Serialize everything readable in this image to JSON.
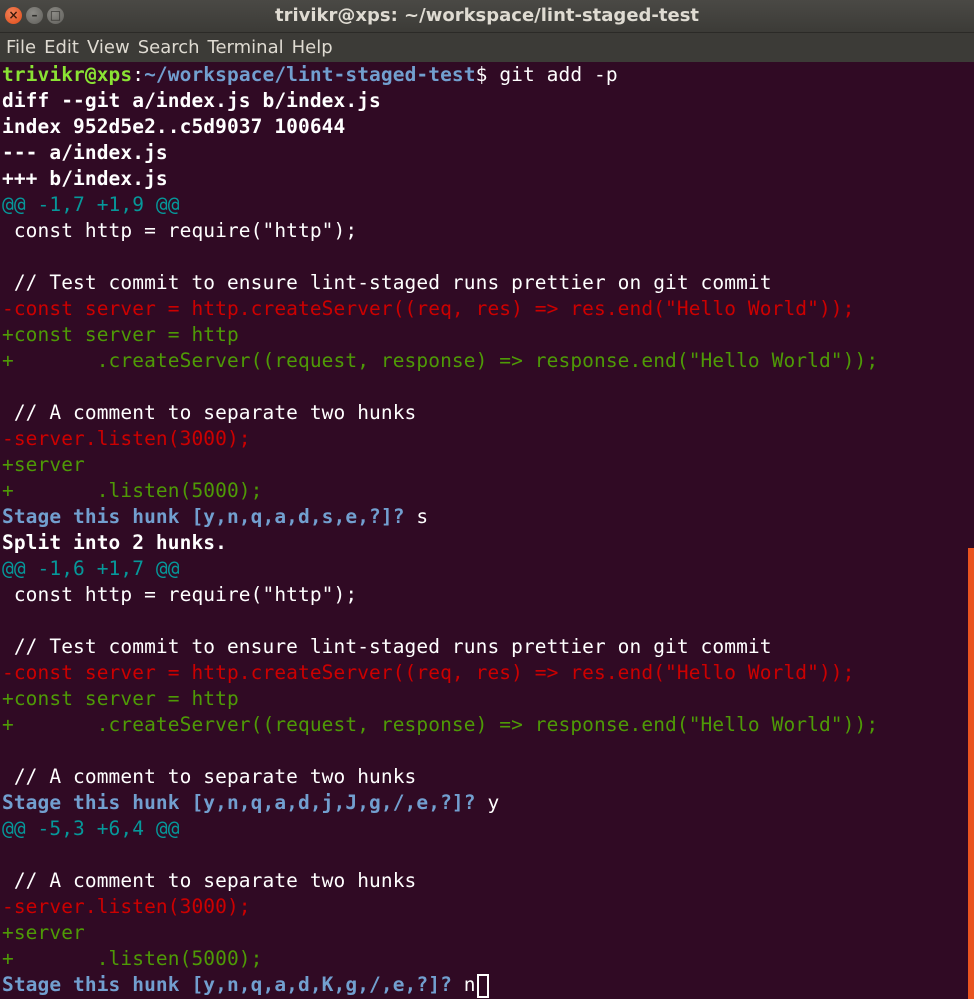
{
  "window": {
    "title": "trivikr@xps: ~/workspace/lint-staged-test",
    "close_glyph": "×",
    "min_glyph": "–",
    "max_glyph": "□"
  },
  "menu": {
    "items": [
      "File",
      "Edit",
      "View",
      "Search",
      "Terminal",
      "Help"
    ]
  },
  "terminal": {
    "prompt_user": "trivikr@xps",
    "prompt_sep": ":",
    "prompt_path": "~/workspace/lint-staged-test",
    "prompt_end": "$ ",
    "command": "git add -p",
    "lines": [
      {
        "t": "diff --git a/index.js b/index.js",
        "c": "b"
      },
      {
        "t": "index 952d5e2..c5d9037 100644",
        "c": "b"
      },
      {
        "t": "--- a/index.js",
        "c": "b"
      },
      {
        "t": "+++ b/index.js",
        "c": "b"
      },
      {
        "t": "@@ -1,7 +1,9 @@",
        "c": "hunk"
      },
      {
        "t": " const http = require(\"http\");",
        "c": ""
      },
      {
        "t": "",
        "c": ""
      },
      {
        "t": " // Test commit to ensure lint-staged runs prettier on git commit",
        "c": ""
      },
      {
        "t": "-const server = http.createServer((req, res) => res.end(\"Hello World\"));",
        "c": "del"
      },
      {
        "t": "+const server = http",
        "c": "add"
      },
      {
        "t": "+       .createServer((request, response) => response.end(\"Hello World\"));",
        "c": "add"
      },
      {
        "t": "",
        "c": ""
      },
      {
        "t": " // A comment to separate two hunks",
        "c": ""
      },
      {
        "t": "-server.listen(3000);",
        "c": "del"
      },
      {
        "t": "+server",
        "c": "add"
      },
      {
        "t": "+       .listen(5000);",
        "c": "add"
      },
      {
        "t": "Stage this hunk [y,n,q,a,d,s,e,?]? ",
        "c": "ask",
        "answer": "s"
      },
      {
        "t": "Split into 2 hunks.",
        "c": "b"
      },
      {
        "t": "@@ -1,6 +1,7 @@",
        "c": "hunk"
      },
      {
        "t": " const http = require(\"http\");",
        "c": ""
      },
      {
        "t": "",
        "c": ""
      },
      {
        "t": " // Test commit to ensure lint-staged runs prettier on git commit",
        "c": ""
      },
      {
        "t": "-const server = http.createServer((req, res) => res.end(\"Hello World\"));",
        "c": "del"
      },
      {
        "t": "+const server = http",
        "c": "add"
      },
      {
        "t": "+       .createServer((request, response) => response.end(\"Hello World\"));",
        "c": "add"
      },
      {
        "t": "",
        "c": ""
      },
      {
        "t": " // A comment to separate two hunks",
        "c": ""
      },
      {
        "t": "Stage this hunk [y,n,q,a,d,j,J,g,/,e,?]? ",
        "c": "ask",
        "answer": "y"
      },
      {
        "t": "@@ -5,3 +6,4 @@",
        "c": "hunk"
      },
      {
        "t": "",
        "c": ""
      },
      {
        "t": " // A comment to separate two hunks",
        "c": ""
      },
      {
        "t": "-server.listen(3000);",
        "c": "del"
      },
      {
        "t": "+server",
        "c": "add"
      },
      {
        "t": "+       .listen(5000);",
        "c": "add"
      },
      {
        "t": "Stage this hunk [y,n,q,a,d,K,g,/,e,?]? ",
        "c": "ask",
        "answer": "n",
        "cursor": true
      }
    ]
  },
  "scrollbar": {
    "thumb_color": "#e95420"
  }
}
